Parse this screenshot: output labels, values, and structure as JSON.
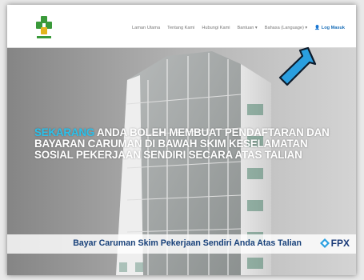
{
  "nav": {
    "items": [
      {
        "label": "Laman Utama"
      },
      {
        "label": "Tentang Kami"
      },
      {
        "label": "Hubungi Kami"
      },
      {
        "label": "Bantuan ▾"
      },
      {
        "label": "Bahasa (Language) ▾"
      }
    ],
    "login_label": "Log Masuk",
    "login_icon": "user-icon",
    "logo_text": "PERKESO"
  },
  "hero": {
    "headline_accent": "SEKARANG",
    "headline_rest": " ANDA BOLEH MEMBUAT PENDAFTARAN DAN BAYARAN CARUMAN DI BAWAH SKIM KESELAMATAN SOSIAL PEKERJAAN SENDIRI SECARA ATAS TALIAN",
    "banner_text": "Bayar Caruman Skim Pekerjaan Sendiri Anda Atas Talian",
    "fpx_label": "FPX"
  },
  "colors": {
    "accent": "#2bc0ea",
    "banner_text": "#18417a",
    "login": "#1b6fb8",
    "arrow": "#2a9fe0",
    "logo_green": "#3a9a3a",
    "logo_gold": "#e3b51c"
  }
}
